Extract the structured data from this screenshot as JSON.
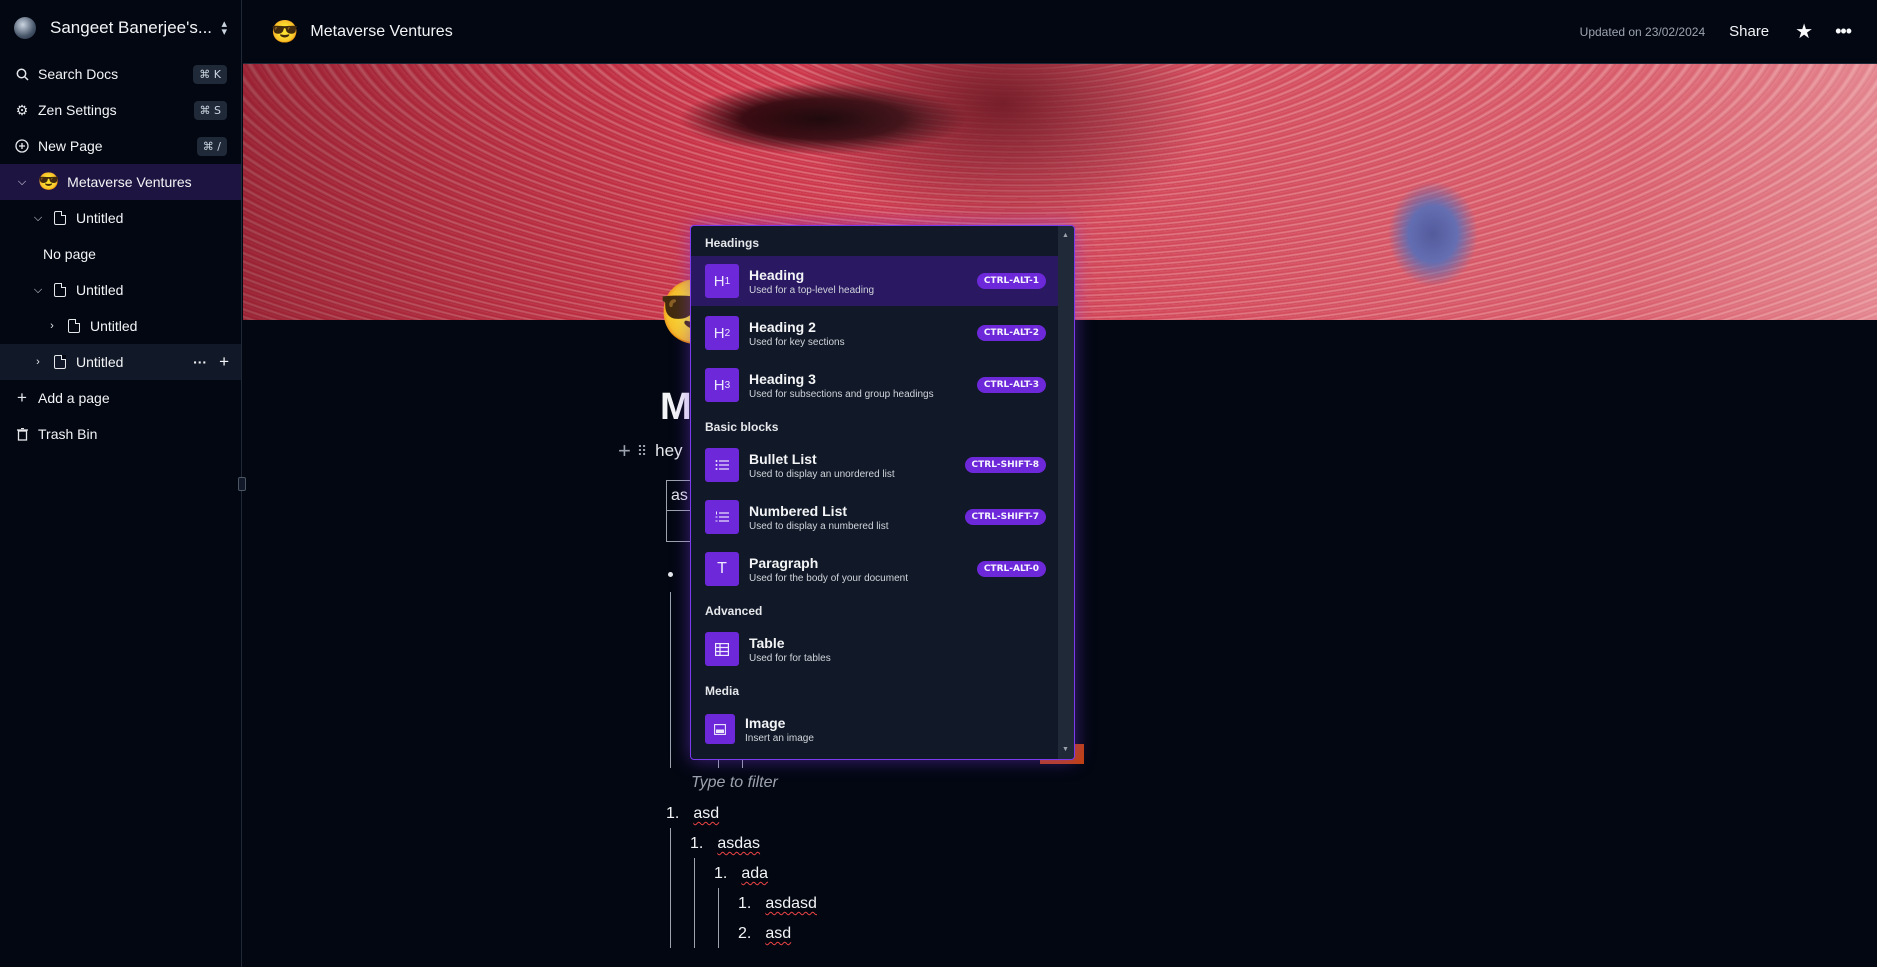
{
  "sidebar": {
    "workspace_name": "Sangeet Banerjee's...",
    "nav": [
      {
        "label": "Search Docs",
        "shortcut": "⌘ K"
      },
      {
        "label": "Zen Settings",
        "shortcut": "⌘ S"
      },
      {
        "label": "New Page",
        "shortcut": "⌘ /"
      }
    ],
    "tree": {
      "root_emoji": "😎",
      "root": "Metaverse Ventures",
      "child1": "Untitled",
      "no_page": "No page",
      "child2": "Untitled",
      "grandchild": "Untitled",
      "child3": "Untitled",
      "more": "···",
      "add": "+"
    },
    "add_page": "Add a page",
    "trash": "Trash Bin"
  },
  "topbar": {
    "emoji": "😎",
    "title": "Metaverse Ventures",
    "updated": "Updated on 23/02/2024",
    "share": "Share"
  },
  "editor": {
    "emoji": "😎",
    "title_partial": "M",
    "line_partial": "hey",
    "table_cell": "as",
    "filter_placeholder": "Type to filter",
    "numbered": [
      {
        "n": "1.",
        "text": "asd"
      },
      {
        "n": "1.",
        "text": "asdas"
      },
      {
        "n": "1.",
        "text": "ada"
      },
      {
        "n": "1.",
        "text": "asdasd"
      },
      {
        "n": "2.",
        "text": "asd"
      }
    ]
  },
  "slash_menu": {
    "sections": {
      "headings": "Headings",
      "basic": "Basic blocks",
      "advanced": "Advanced",
      "media": "Media"
    },
    "items": [
      {
        "icon": "H1",
        "title": "Heading",
        "desc": "Used for a top-level heading",
        "shortcut": "CTRL-ALT-1"
      },
      {
        "icon": "H2",
        "title": "Heading 2",
        "desc": "Used for key sections",
        "shortcut": "CTRL-ALT-2"
      },
      {
        "icon": "H3",
        "title": "Heading 3",
        "desc": "Used for subsections and group headings",
        "shortcut": "CTRL-ALT-3"
      },
      {
        "icon": "bullet-list",
        "title": "Bullet List",
        "desc": "Used to display an unordered list",
        "shortcut": "CTRL-SHIFT-8"
      },
      {
        "icon": "numbered-list",
        "title": "Numbered List",
        "desc": "Used to display a numbered list",
        "shortcut": "CTRL-SHIFT-7"
      },
      {
        "icon": "T",
        "title": "Paragraph",
        "desc": "Used for the body of your document",
        "shortcut": "CTRL-ALT-0"
      },
      {
        "icon": "table",
        "title": "Table",
        "desc": "Used for for tables",
        "shortcut": ""
      },
      {
        "icon": "image",
        "title": "Image",
        "desc": "Insert an image",
        "shortcut": ""
      }
    ]
  },
  "colors": {
    "accent": "#6d28d9",
    "selected": "#2a1863",
    "background": "#030712"
  }
}
